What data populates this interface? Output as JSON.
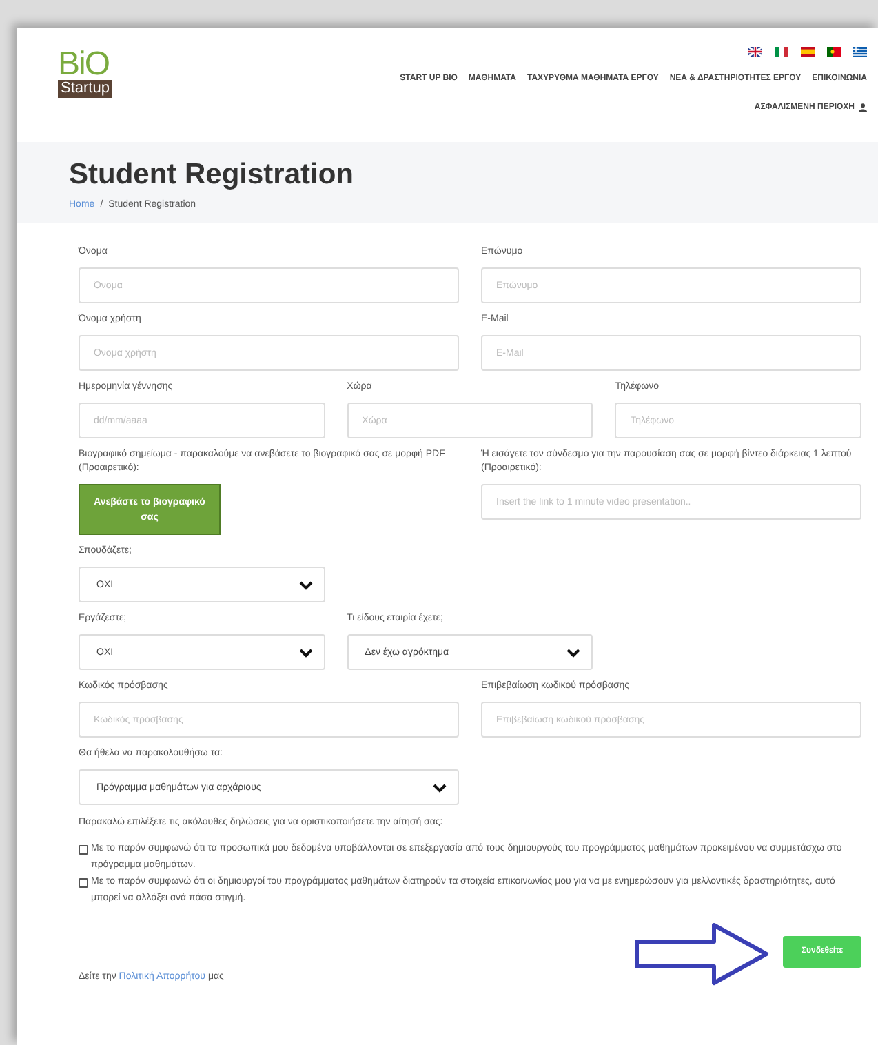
{
  "header": {
    "logo": {
      "top": "BiO",
      "bottom": "Startup"
    },
    "nav": [
      "START UP BIO",
      "ΜΑΘΗΜΑΤΑ",
      "ΤΑΧΥΡΥΘΜΑ ΜΑΘΗΜΑΤΑ ΕΡΓΟΥ",
      "ΝΕΑ & ΔΡΑΣΤΗΡΙΟΤΗΤΕΣ ΕΡΓΟΥ",
      "ΕΠΙΚΟΙΝΩΝΙΑ"
    ],
    "user_area": "ΑΣΦΑΛΙΣΜΕΝΗ ΠΕΡΙΟΧΗ"
  },
  "page_title": "Student Registration",
  "breadcrumb": {
    "separator": "/",
    "items": [
      {
        "label": "Home",
        "kind": "link"
      },
      {
        "label": "Student Registration",
        "kind": "current"
      }
    ]
  },
  "form": {
    "rows": [
      {
        "kind": "halves",
        "fields": [
          {
            "kind": "text",
            "label": "Όνομα",
            "placeholder": "Όνομα"
          },
          {
            "kind": "text",
            "label": "Επώνυμο",
            "placeholder": "Επώνυμο"
          }
        ]
      },
      {
        "kind": "halves",
        "fields": [
          {
            "kind": "text",
            "label": "Όνομα χρήστη",
            "placeholder": "Όνομα χρήστη"
          },
          {
            "kind": "text",
            "label": "E-Mail",
            "placeholder": "E-Mail"
          }
        ]
      },
      {
        "kind": "thirds",
        "fields": [
          {
            "kind": "text",
            "label": "Ημερομηνία γέννησης",
            "placeholder": "dd/mm/aaaa"
          },
          {
            "kind": "text",
            "label": "Χώρα",
            "placeholder": "Χώρα"
          },
          {
            "kind": "text",
            "label": "Τηλέφωνο",
            "placeholder": "Τηλέφωνο"
          }
        ]
      },
      {
        "kind": "halves",
        "fields": [
          {
            "kind": "upload",
            "label": "Βιογραφικό σημείωμα - παρακαλούμε να ανεβάσετε το βιογραφικό σας σε μορφή PDF (Προαιρετικό):",
            "button": "Ανεβάστε το βιογραφικό σας"
          },
          {
            "kind": "text",
            "label": "Ή εισάγετε τον σύνδεσμο για την παρουσίαση σας σε μορφή βίντεο διάρκειας 1 λεπτού (Προαιρετικό):",
            "placeholder": "Insert the link to 1 minute video presentation.."
          }
        ]
      },
      {
        "kind": "thirds",
        "fields": [
          {
            "kind": "select",
            "label": "Σπουδάζετε;",
            "value": "ΟΧΙ"
          }
        ]
      },
      {
        "kind": "thirds",
        "fields": [
          {
            "kind": "select",
            "label": "Εργάζεστε;",
            "value": "ΟΧΙ"
          },
          {
            "kind": "select",
            "label": "Τι είδους εταιρία έχετε;",
            "value": "Δεν έχω αγρόκτημα"
          }
        ]
      },
      {
        "kind": "halves",
        "fields": [
          {
            "kind": "text",
            "label": "Κωδικός πρόσβασης",
            "placeholder": "Κωδικός πρόσβασης"
          },
          {
            "kind": "text",
            "label": "Επιβεβαίωση κωδικού πρόσβασης",
            "placeholder": "Επιβεβαίωση κωδικού πρόσβασης"
          }
        ]
      },
      {
        "kind": "halves",
        "fields": [
          {
            "kind": "select",
            "label": "Θα ήθελα να παρακολουθήσω τα:",
            "value": "Πρόγραμμα μαθημάτων για αρχάριους"
          }
        ]
      }
    ],
    "declarations_intro": "Παρακαλώ επιλέξετε τις ακόλουθες δηλώσεις για να οριστικοποιήσετε την αίτησή σας:",
    "declarations": [
      {
        "text": "Με το παρόν συμφωνώ ότι τα προσωπικά μου δεδομένα υποβάλλονται σε επεξεργασία από τους δημιουργούς του προγράμματος μαθημάτων προκειμένου να συμμετάσχω στο πρόγραμμα μαθημάτων.",
        "checked": false
      },
      {
        "text": "Με το παρόν συμφωνώ ότι οι δημιουργοί του προγράμματος μαθημάτων διατηρούν τα στοιχεία επικοινωνίας μου για να με ενημερώσουν για μελλοντικές δραστηριότητες, αυτό μπορεί να αλλάξει ανά πάσα στιγμή.",
        "checked": false
      }
    ],
    "privacy": {
      "before": "Δείτε την",
      "link": "Πολιτική Απορρήτου",
      "after": "μας"
    },
    "submit": "Συνδεθείτε"
  }
}
